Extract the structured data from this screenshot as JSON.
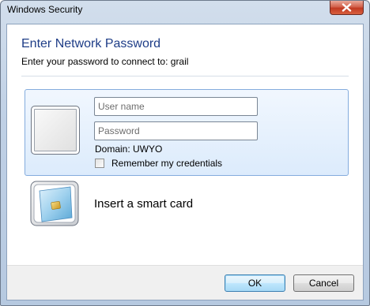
{
  "window": {
    "title": "Windows Security",
    "close_icon": "close-icon"
  },
  "dialog": {
    "heading": "Enter Network Password",
    "subheading": "Enter your password to connect to: grail"
  },
  "credentials": {
    "user_tile_icon": "user-tile-icon",
    "username_placeholder": "User name",
    "username_value": "",
    "password_placeholder": "Password",
    "password_value": "",
    "domain_label": "Domain: UWYO",
    "remember_label": "Remember my credentials",
    "remember_checked": false
  },
  "smartcard": {
    "icon": "smart-card-icon",
    "label": "Insert a smart card"
  },
  "buttons": {
    "ok_label": "OK",
    "cancel_label": "Cancel"
  },
  "colors": {
    "heading": "#1e3d87",
    "selected_tile_border": "#84acdd",
    "close_button": "#c13a22"
  }
}
